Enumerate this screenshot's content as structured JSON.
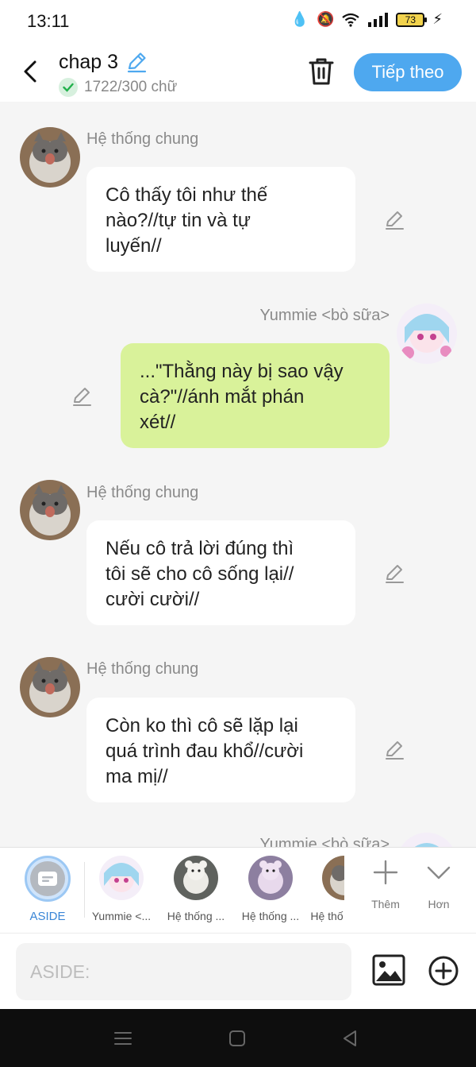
{
  "status_bar": {
    "time": "13:11",
    "battery": "73"
  },
  "header": {
    "title": "chap 3",
    "word_count": "1722/300 chữ",
    "next_label": "Tiếp theo"
  },
  "messages": [
    {
      "side": "left",
      "sender": "Hệ thống chung",
      "lines": [
        "Cô thấy tôi như thế",
        "nào?//tự tin và tự",
        "luyến//"
      ]
    },
    {
      "side": "right",
      "sender": "Yummie <bò sữa>",
      "lines": [
        "...\"Thằng này bị sao vậy",
        "cà?\"//ánh mắt phán",
        "xét//"
      ]
    },
    {
      "side": "left",
      "sender": "Hệ thống chung",
      "lines": [
        "Nếu cô trả lời đúng thì",
        "tôi sẽ cho cô sống lại//",
        "cười cười//"
      ]
    },
    {
      "side": "left",
      "sender": "Hệ thống chung",
      "lines": [
        "Còn ko thì cô sẽ lặp lại",
        "quá trình đau khổ//cười",
        "ma mị//"
      ]
    },
    {
      "side": "right",
      "sender": "Yummie <bò sữa>",
      "lines": []
    }
  ],
  "character_strip": {
    "aside_label": "ASIDE",
    "characters": [
      {
        "label": "Yummie <...",
        "avatar": "anime-girl"
      },
      {
        "label": "Hệ thống ...",
        "avatar": "white-teddy"
      },
      {
        "label": "Hệ thống ...",
        "avatar": "pink-teddy"
      },
      {
        "label": "Hệ thố",
        "avatar": "cat"
      }
    ],
    "more_label": "Thêm",
    "expand_label": "Hơn"
  },
  "input": {
    "placeholder": "ASIDE:"
  },
  "colors": {
    "accent": "#4ea8ef",
    "user_bubble": "#d9f29a",
    "system_bubble": "#ffffff",
    "background": "#f5f5f5"
  },
  "icons": [
    "back-icon",
    "edit-icon",
    "check-icon",
    "trash-icon",
    "plus-icon",
    "chevron-down-icon",
    "image-icon",
    "add-circle-icon",
    "menu-icon",
    "home-icon",
    "back-triangle-icon"
  ]
}
